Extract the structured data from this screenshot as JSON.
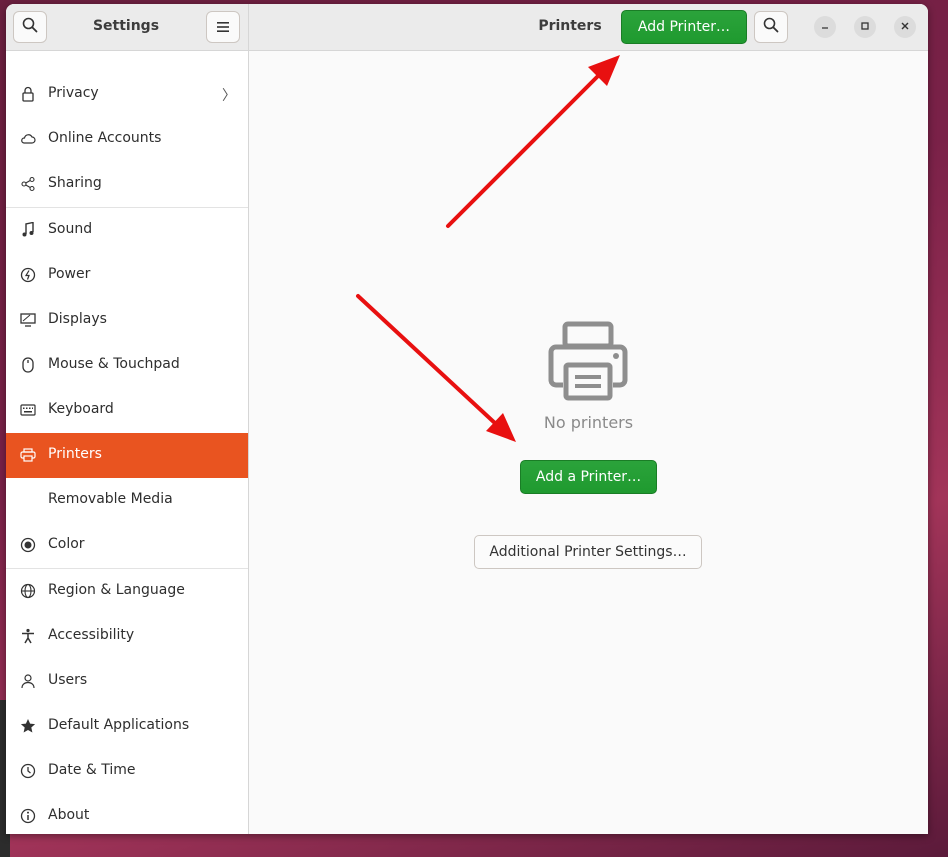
{
  "window": {
    "sidebar_title": "Settings",
    "main_title": "Printers"
  },
  "header": {
    "add_printer_label": "Add Printer…",
    "search_icon": "search-icon",
    "menu_icon": "hamburger-menu-icon",
    "minimize_icon": "minimize-icon",
    "maximize_icon": "maximize-icon",
    "close_icon": "close-icon"
  },
  "sidebar": {
    "items": [
      {
        "label": "Privacy",
        "icon": "lock-icon"
      },
      {
        "label": "Online Accounts",
        "icon": "cloud-icon"
      },
      {
        "label": "Sharing",
        "icon": "share-icon"
      },
      {
        "label": "Sound",
        "icon": "music-note-icon"
      },
      {
        "label": "Power",
        "icon": "power-icon"
      },
      {
        "label": "Displays",
        "icon": "display-icon"
      },
      {
        "label": "Mouse & Touchpad",
        "icon": "mouse-icon"
      },
      {
        "label": "Keyboard",
        "icon": "keyboard-icon"
      },
      {
        "label": "Printers",
        "icon": "printer-icon"
      },
      {
        "label": "Removable Media",
        "icon": "removable-media-icon"
      },
      {
        "label": "Color",
        "icon": "color-icon"
      },
      {
        "label": "Region & Language",
        "icon": "globe-icon"
      },
      {
        "label": "Accessibility",
        "icon": "accessibility-icon"
      },
      {
        "label": "Users",
        "icon": "users-icon"
      },
      {
        "label": "Default Applications",
        "icon": "star-icon"
      },
      {
        "label": "Date & Time",
        "icon": "clock-icon"
      },
      {
        "label": "About",
        "icon": "info-icon"
      }
    ],
    "active": "Printers"
  },
  "main": {
    "empty_icon": "printer-icon",
    "empty_text": "No printers",
    "add_a_printer_label": "Add a Printer…",
    "additional_settings_label": "Additional Printer Settings…"
  },
  "colors": {
    "accent": "#e95420",
    "green_button": "#26a269",
    "annotation_arrow": "#e81010"
  }
}
